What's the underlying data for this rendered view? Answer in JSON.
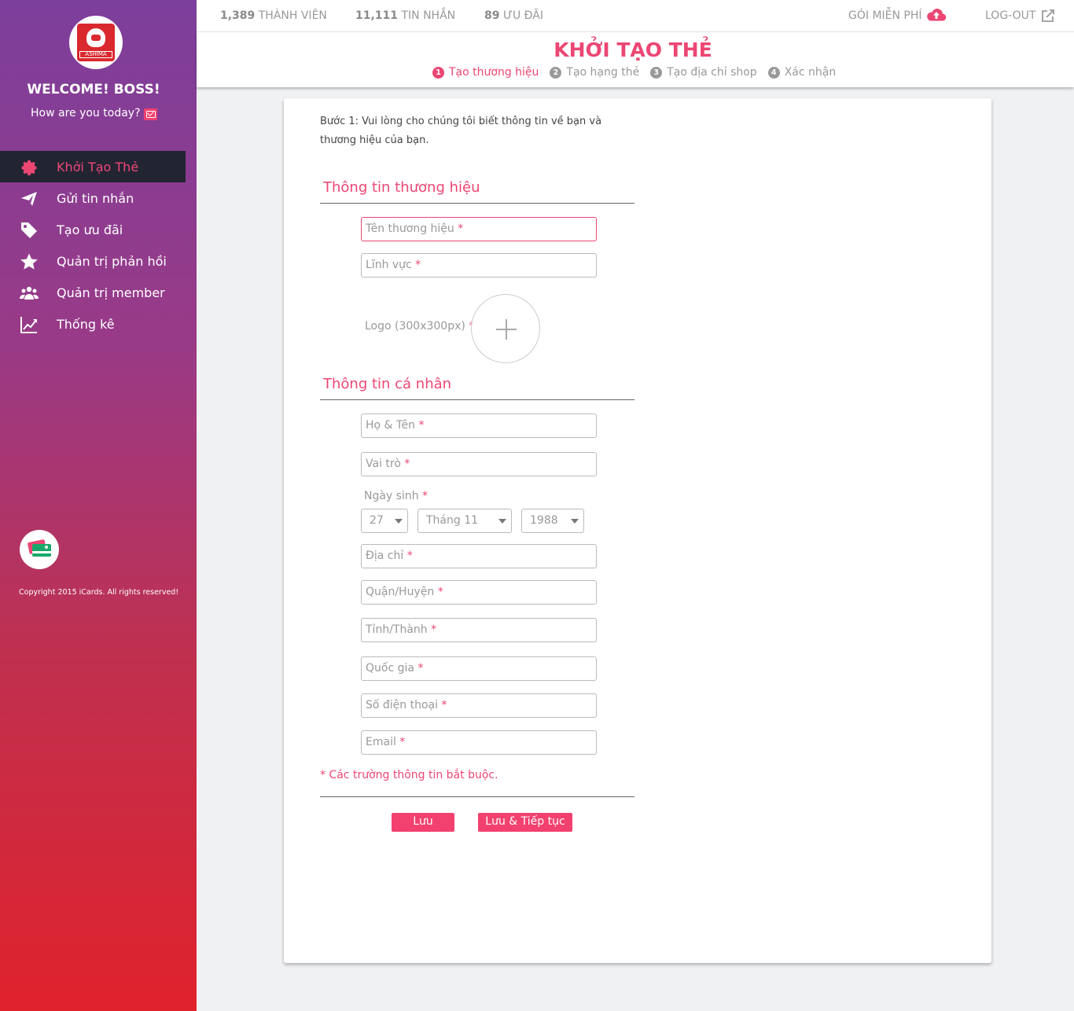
{
  "sidebar": {
    "logo_text": "ASHIMA",
    "welcome": "WELCOME! BOSS!",
    "greeting": "How are you today?",
    "items": [
      {
        "label": "Khởi Tạo Thẻ",
        "icon": "gear-icon"
      },
      {
        "label": "Gửi tin nhắn",
        "icon": "paper-plane-icon"
      },
      {
        "label": "Tạo ưu đãi",
        "icon": "tag-icon"
      },
      {
        "label": "Quản trị phản hồi",
        "icon": "star-icon"
      },
      {
        "label": "Quản trị member",
        "icon": "users-icon"
      },
      {
        "label": "Thống kê",
        "icon": "chart-icon"
      }
    ],
    "copyright": "Copyright 2015 iCards. All rights reserved!"
  },
  "topbar": {
    "members_count": "1,389",
    "members_label": "THÀNH VIÊN",
    "messages_count": "11,111",
    "messages_label": "TIN NHẮN",
    "offers_count": "89",
    "offers_label": "ƯU ĐÃI",
    "plan": "GÓI MIỄN PHÍ",
    "logout": "LOG-OUT"
  },
  "header": {
    "title": "KHỞI TẠO THẺ",
    "steps": [
      {
        "num": "1",
        "label": "Tạo thương hiệu"
      },
      {
        "num": "2",
        "label": "Tạo hạng thẻ"
      },
      {
        "num": "3",
        "label": "Tạo địa chỉ shop"
      },
      {
        "num": "4",
        "label": "Xác nhận"
      }
    ]
  },
  "form": {
    "intro": "Bước 1: Vui lòng cho chúng tôi biết thông tin về bạn và thương hiệu của bạn.",
    "brand_section": "Thông tin thương hiệu",
    "brand_name": "Tên thương hiệu",
    "field_of_business": "Lĩnh vực",
    "logo_label": "Logo (300x300px)",
    "personal_section": "Thông tin cá nhân",
    "full_name": "Họ & Tên",
    "role": "Vai trò",
    "dob_label": "Ngày sinh",
    "dob_day": "27",
    "dob_month": "Tháng 11",
    "dob_year": "1988",
    "address": "Địa chỉ",
    "district": "Quận/Huyện",
    "province": "Tỉnh/Thành",
    "country": "Quốc gia",
    "phone": "Số điện thoại",
    "email": "Email",
    "asterisk": "*",
    "required_note": "* Các trường thông tin bắt buộc.",
    "save": "Lưu",
    "save_continue": "Lưu & Tiếp tục"
  },
  "colors": {
    "accent": "#ec4673",
    "sidebar_top": "#7c3f9c",
    "sidebar_bottom": "#e0222c"
  }
}
